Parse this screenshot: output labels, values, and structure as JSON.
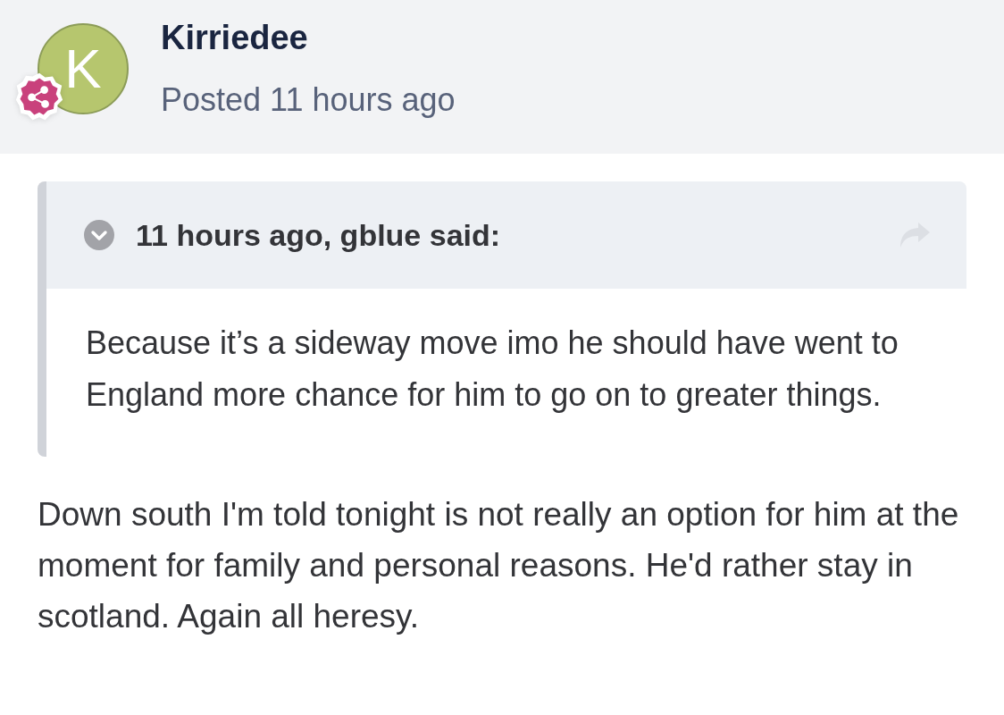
{
  "post": {
    "author": {
      "initial": "K",
      "name": "Kirriedee",
      "posted": "Posted 11 hours ago"
    },
    "quote": {
      "citation": "11 hours ago, gblue said:",
      "text": "Because it’s a sideway move imo he should have went to England more chance for him to go on to greater things."
    },
    "body": "Down south I'm told tonight is not really an option for him at the moment for family and personal reasons. He'd rather stay in scotland. Again all heresy."
  }
}
